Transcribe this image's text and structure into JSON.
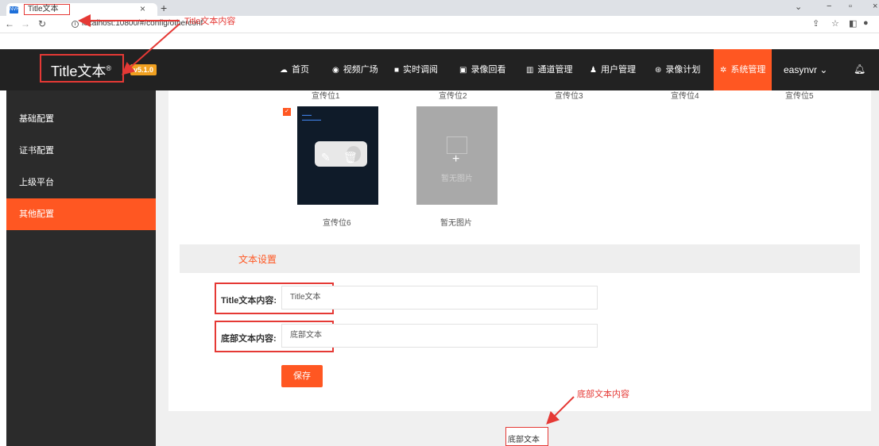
{
  "browser": {
    "tab_title": "Title文本",
    "tab_favicon": "NVR",
    "url": "localhost:10800/#/config/otherconf"
  },
  "header": {
    "logo": "Title文本",
    "logo_mark": "®",
    "version": "v5.1.0",
    "nav": [
      {
        "icon": "cloud-icon",
        "label": "首页"
      },
      {
        "icon": "play-circle-icon",
        "label": "视频广场"
      },
      {
        "icon": "video-icon",
        "label": "实时调阅"
      },
      {
        "icon": "record-icon",
        "label": "录像回看"
      },
      {
        "icon": "columns-icon",
        "label": "通道管理"
      },
      {
        "icon": "user-icon",
        "label": "用户管理"
      },
      {
        "icon": "calendar-icon",
        "label": "录像计划"
      },
      {
        "icon": "gear-icon",
        "label": "系统管理"
      }
    ],
    "user": "easynvr"
  },
  "sidebar": {
    "items": [
      "基础配置",
      "证书配置",
      "上级平台",
      "其他配置"
    ],
    "active_index": 3
  },
  "promo": {
    "labels_top": [
      "宣传位1",
      "宣传位2",
      "宣传位3",
      "宣传位4",
      "宣传位5"
    ],
    "slot6_label": "宣传位6",
    "empty_text": "暂无图片",
    "empty_label": "暂无图片"
  },
  "text_settings": {
    "section_title": "文本设置",
    "title_label": "Title文本内容:",
    "title_value": "Title文本",
    "footer_label": "底部文本内容:",
    "footer_value": "底部文本",
    "save_label": "保存"
  },
  "footer": {
    "text": "底部文本"
  },
  "annotations": {
    "tab_note": "Title文本内容",
    "footer_note": "底部文本内容"
  },
  "colors": {
    "accent": "#ff5722",
    "annotation": "#e53935",
    "header_bg": "#222222",
    "sidebar_bg": "#2b2b2b"
  }
}
